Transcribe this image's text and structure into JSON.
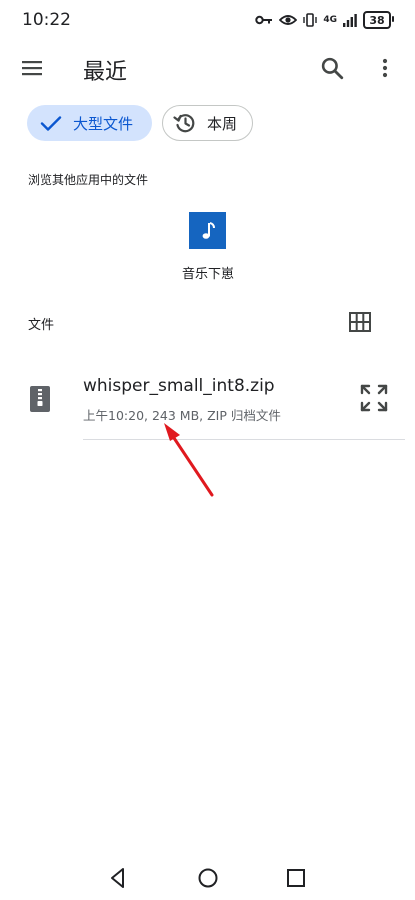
{
  "status_bar": {
    "time": "10:22",
    "network": "4G",
    "battery": "38"
  },
  "app_bar": {
    "title": "最近"
  },
  "filters": {
    "large_files": "大型文件",
    "this_week": "本周"
  },
  "browse_apps": {
    "title": "浏览其他应用中的文件",
    "apps": [
      {
        "label": "音乐下崽"
      }
    ]
  },
  "files_section": {
    "title": "文件",
    "items": [
      {
        "name": "whisper_small_int8.zip",
        "meta": "上午10:20, 243 MB, ZIP 归档文件"
      }
    ]
  },
  "colors": {
    "accent": "#0b57d0",
    "chip_selected_bg": "#d3e3fd",
    "app_icon_bg": "#1565c0",
    "annotation": "#e0191f"
  },
  "icons": {
    "menu": "menu-icon",
    "search": "search-icon",
    "more": "more-vert-icon",
    "check": "check-icon",
    "history": "history-icon",
    "music": "music-note-icon",
    "grid": "grid-view-icon",
    "zip": "zip-file-icon",
    "expand": "expand-icon"
  }
}
